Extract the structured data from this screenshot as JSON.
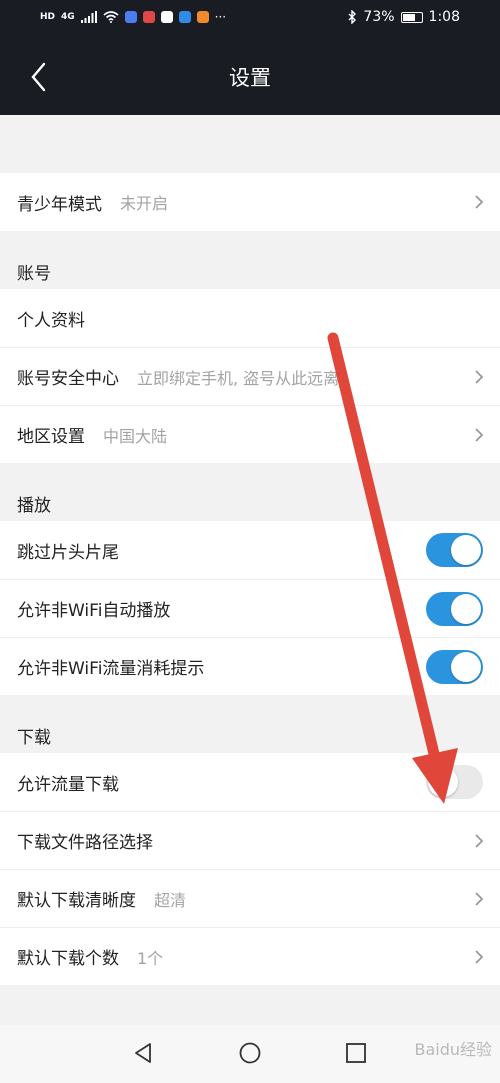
{
  "status_bar": {
    "network_tag": "HD",
    "signal_tag": "4G",
    "battery": "73%",
    "battery_level": 0.73,
    "time": "1:08",
    "dots": "···"
  },
  "nav": {
    "title": "设置"
  },
  "rows": {
    "youth_mode": {
      "label": "青少年模式",
      "value": "未开启"
    },
    "profile": {
      "label": "个人资料"
    },
    "account_security": {
      "label": "账号安全中心",
      "value": "立即绑定手机, 盗号从此远离"
    },
    "region": {
      "label": "地区设置",
      "value": "中国大陆"
    },
    "skip_intro": {
      "label": "跳过片头片尾",
      "enabled": true
    },
    "non_wifi_autoplay": {
      "label": "允许非WiFi自动播放",
      "enabled": true
    },
    "non_wifi_data_alert": {
      "label": "允许非WiFi流量消耗提示",
      "enabled": true
    },
    "data_download": {
      "label": "允许流量下载",
      "enabled": false
    },
    "download_path": {
      "label": "下载文件路径选择"
    },
    "download_quality": {
      "label": "默认下载清晰度",
      "value": "超清"
    },
    "download_count": {
      "label": "默认下载个数",
      "value": "1个"
    }
  },
  "sections": {
    "account": "账号",
    "playback": "播放",
    "download": "下载"
  },
  "watermark": "Baidu经验",
  "colors": {
    "header_bg": "#191d23",
    "toggle_on": "#2b94de",
    "annotation_arrow": "#e0463a"
  }
}
